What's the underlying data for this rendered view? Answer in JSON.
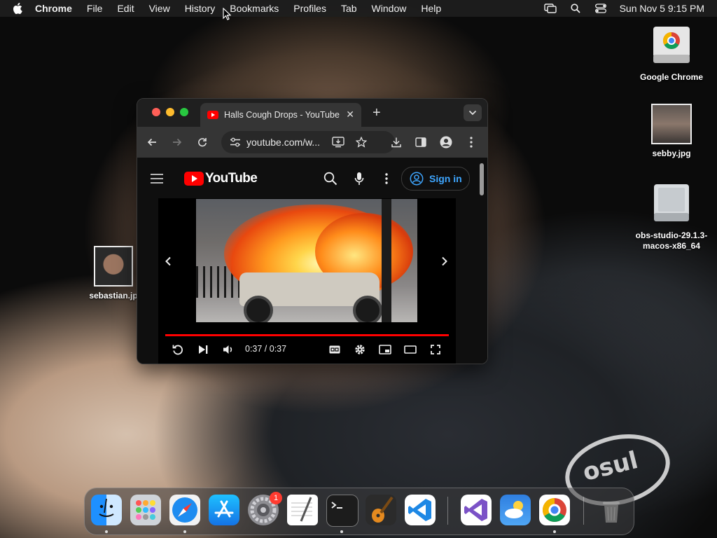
{
  "menubar": {
    "app_name": "Chrome",
    "items": [
      "File",
      "Edit",
      "View",
      "History",
      "Bookmarks",
      "Profiles",
      "Tab",
      "Window",
      "Help"
    ],
    "datetime": "Sun Nov 5  9:15 PM"
  },
  "browser": {
    "tab_title": "Halls Cough Drops - YouTube",
    "new_tab": "+",
    "url": "youtube.com/w...",
    "youtube": {
      "logo_text": "YouTube",
      "sign_in": "Sign in",
      "player": {
        "time": "0:37 / 0:37",
        "progress": 1.0
      }
    }
  },
  "desktop": {
    "icons": [
      {
        "label": "Google Chrome"
      },
      {
        "label": "sebby.jpg"
      },
      {
        "label": "obs-studio-29.1.3-macos-x86_64"
      },
      {
        "label": "sebastian.jp"
      }
    ]
  },
  "dock": {
    "apps": [
      "Finder",
      "Launchpad",
      "Safari",
      "App Store",
      "System Settings",
      "TextEdit",
      "Terminal",
      "GarageBand",
      "Visual Studio Code",
      "Visual Studio",
      "Weather",
      "Google Chrome",
      "Trash"
    ],
    "settings_badge": "1"
  },
  "colors": {
    "youtube_red": "#ff0000",
    "link_blue": "#3ea6ff",
    "menubar_bg": "#1e1e1e"
  },
  "wallpaper_text": "osul"
}
